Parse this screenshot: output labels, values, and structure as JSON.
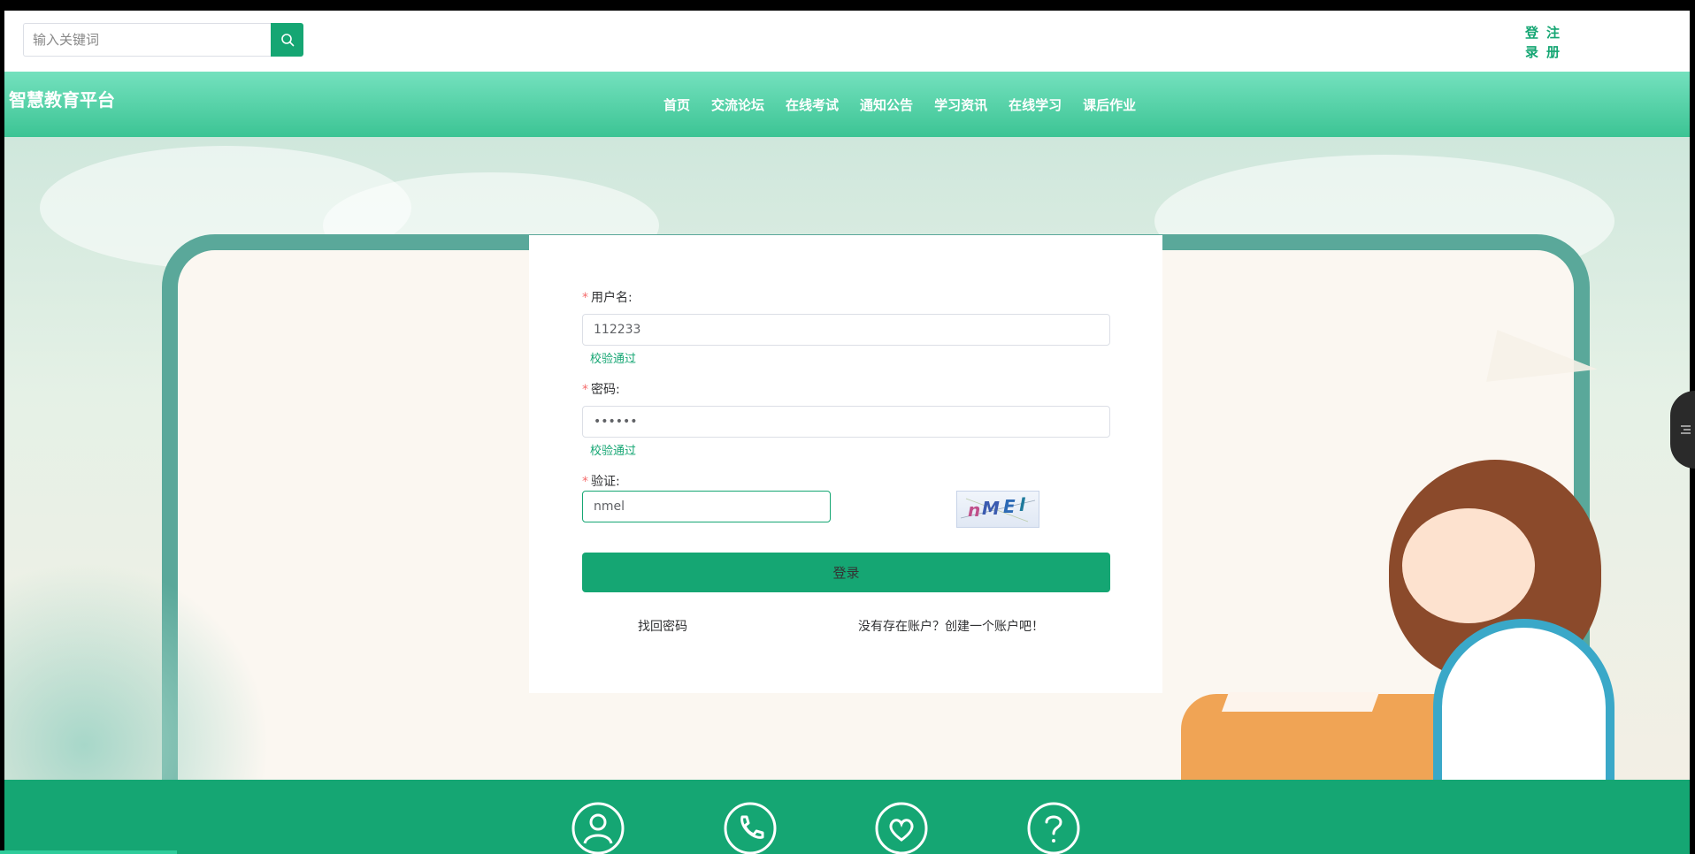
{
  "topbar": {
    "search_placeholder": "输入关键词",
    "auth_login": "登录",
    "auth_register": "注册"
  },
  "header": {
    "brand": "智慧教育平台",
    "nav": [
      "首页",
      "交流论坛",
      "在线考试",
      "通知公告",
      "学习资讯",
      "在线学习",
      "课后作业"
    ]
  },
  "login_form": {
    "username": {
      "label": "用户名:",
      "value": "112233",
      "message": "校验通过"
    },
    "password": {
      "label": "密码:",
      "value": "••••••",
      "message": "校验通过"
    },
    "captcha": {
      "label": "验证:",
      "value": "nmel",
      "image_text": "nMEl"
    },
    "submit_label": "登录",
    "forgot_password": "找回密码",
    "register_prompt": "没有存在账户？创建一个账户吧！"
  },
  "footer": {
    "icons": [
      "user-icon",
      "phone-icon",
      "heart-icon",
      "question-icon"
    ]
  },
  "colors": {
    "accent": "#15a673",
    "header_gradient_top": "#74e1be",
    "header_gradient_bottom": "#3cc494",
    "error_mark": "#f56c6c"
  }
}
